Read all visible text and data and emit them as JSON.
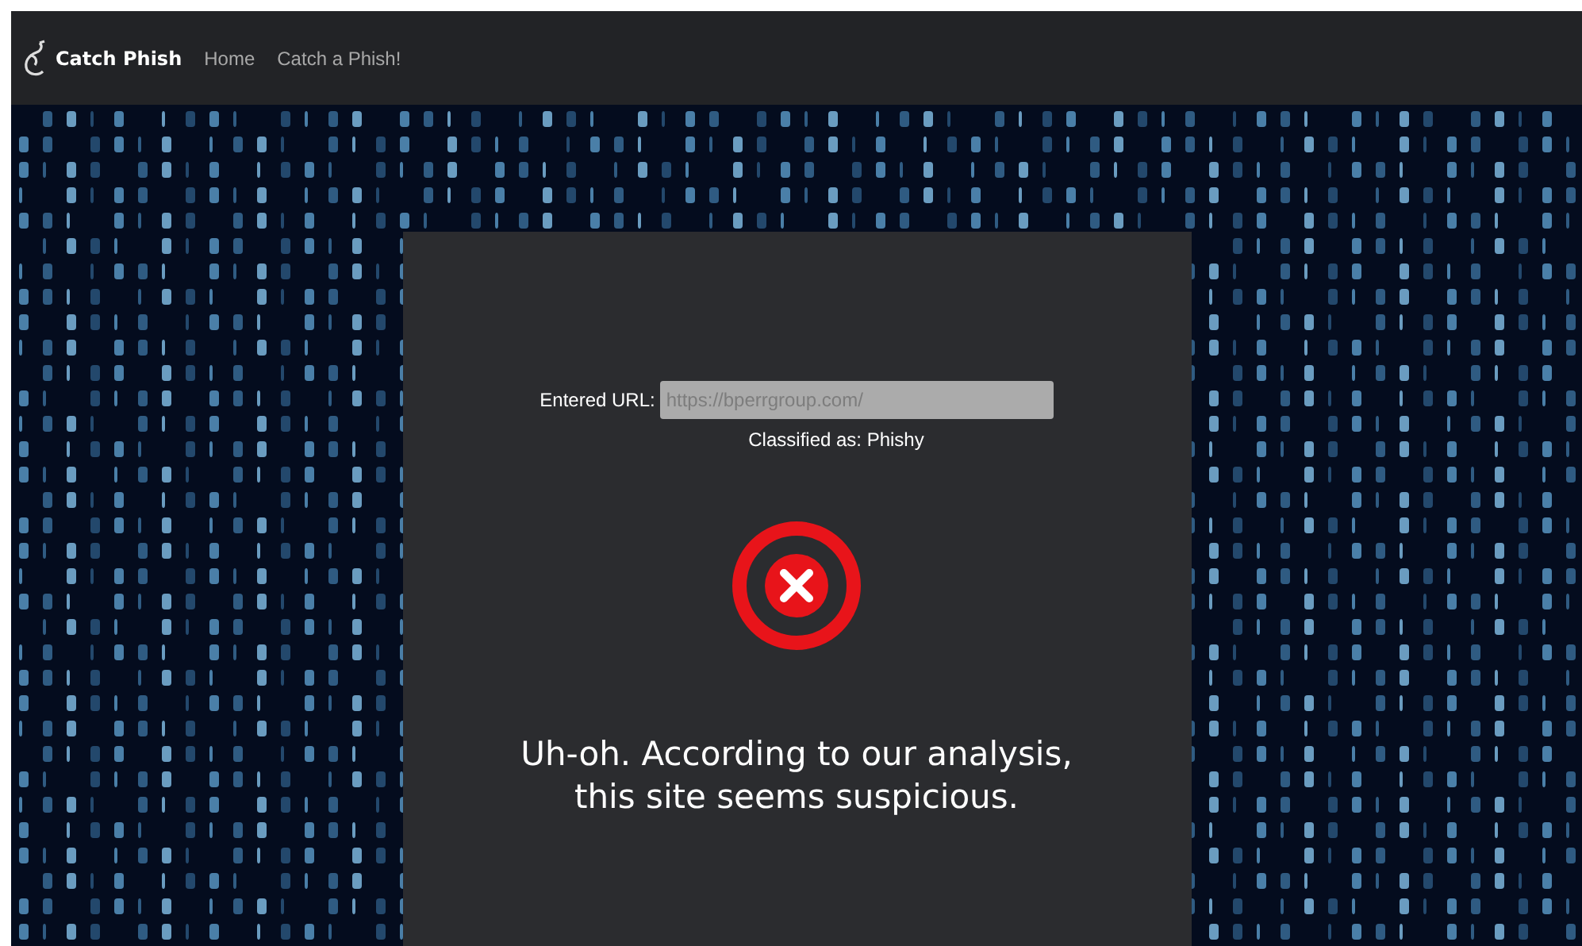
{
  "navbar": {
    "brand": "Catch Phish",
    "links": [
      "Home",
      "Catch a Phish!"
    ]
  },
  "result": {
    "url_label": "Entered URL:",
    "url_value": "https://bperrgroup.com/",
    "classification": "Classified as: Phishy",
    "suspicious": true,
    "message": "Uh-oh. According to our analysis, this site seems suspicious."
  }
}
